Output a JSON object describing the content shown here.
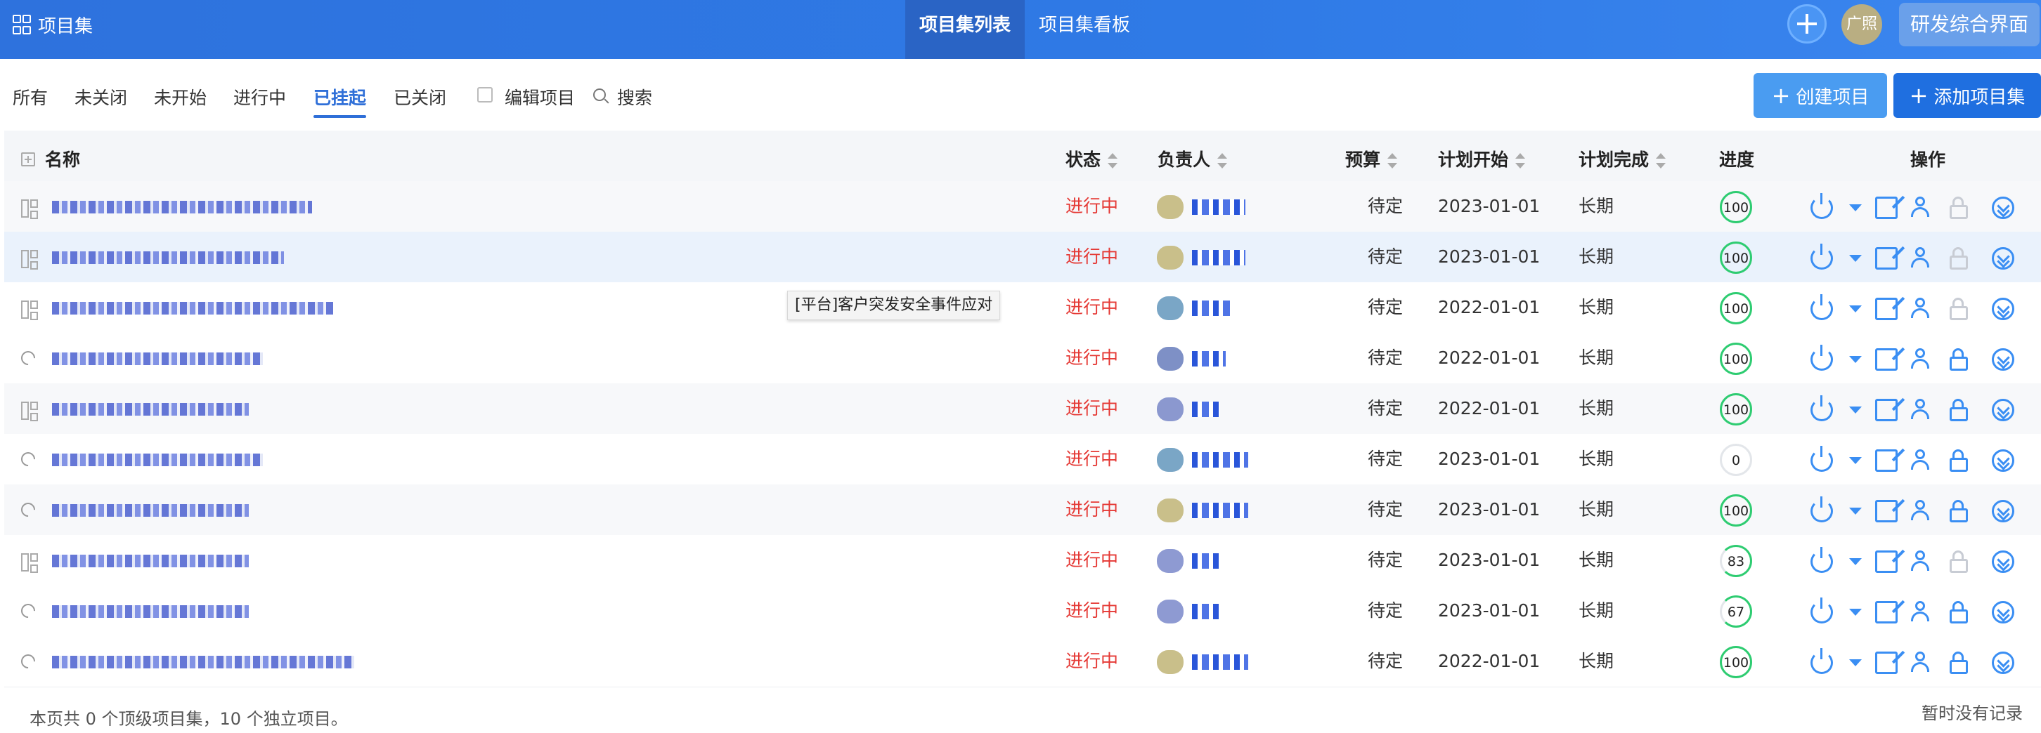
{
  "header": {
    "app_title": "项目集",
    "tabs": [
      {
        "label": "项目集列表",
        "active": true
      },
      {
        "label": "项目集看板",
        "active": false
      }
    ],
    "user_name": "广照",
    "rd_button": "研发综合界面"
  },
  "filters": {
    "tabs": [
      "所有",
      "未关闭",
      "未开始",
      "进行中",
      "已挂起",
      "已关闭"
    ],
    "active_tab": "已挂起",
    "edit_checkbox_label": "编辑项目",
    "search_label": "搜索"
  },
  "actions": {
    "create_project": "创建项目",
    "add_program": "添加项目集"
  },
  "table": {
    "headers": {
      "name": "名称",
      "status": "状态",
      "owner": "负责人",
      "budget": "预算",
      "plan_start": "计划开始",
      "plan_end": "计划完成",
      "progress": "进度",
      "ops": "操作"
    },
    "rows": [
      {
        "type": "program",
        "status": "进行中",
        "budget": "待定",
        "plan_start": "2023-01-01",
        "plan_end": "长期",
        "progress": "100",
        "progress_value": 100,
        "locked": false
      },
      {
        "type": "program",
        "status": "进行中",
        "budget": "待定",
        "plan_start": "2023-01-01",
        "plan_end": "长期",
        "progress": "100",
        "progress_value": 100,
        "locked": false
      },
      {
        "type": "program",
        "status": "进行中",
        "budget": "待定",
        "plan_start": "2022-01-01",
        "plan_end": "长期",
        "progress": "100",
        "progress_value": 100,
        "locked": false
      },
      {
        "type": "project",
        "status": "进行中",
        "budget": "待定",
        "plan_start": "2022-01-01",
        "plan_end": "长期",
        "progress": "100",
        "progress_value": 100,
        "locked": true
      },
      {
        "type": "program",
        "status": "进行中",
        "budget": "待定",
        "plan_start": "2022-01-01",
        "plan_end": "长期",
        "progress": "100",
        "progress_value": 100,
        "locked": true
      },
      {
        "type": "project",
        "status": "进行中",
        "budget": "待定",
        "plan_start": "2023-01-01",
        "plan_end": "长期",
        "progress": "0",
        "progress_value": 0,
        "locked": true
      },
      {
        "type": "project",
        "status": "进行中",
        "budget": "待定",
        "plan_start": "2023-01-01",
        "plan_end": "长期",
        "progress": "100",
        "progress_value": 100,
        "locked": true
      },
      {
        "type": "program",
        "status": "进行中",
        "budget": "待定",
        "plan_start": "2023-01-01",
        "plan_end": "长期",
        "progress": "83",
        "progress_value": 83,
        "locked": false
      },
      {
        "type": "project",
        "status": "进行中",
        "budget": "待定",
        "plan_start": "2023-01-01",
        "plan_end": "长期",
        "progress": "67",
        "progress_value": 67,
        "locked": true
      },
      {
        "type": "project",
        "status": "进行中",
        "budget": "待定",
        "plan_start": "2022-01-01",
        "plan_end": "长期",
        "progress": "100",
        "progress_value": 100,
        "locked": true
      }
    ]
  },
  "tooltip": "[平台]客户突发安全事件应对",
  "footer": {
    "summary": "本页共 0 个顶级项目集，10 个独立项目。",
    "no_records": "暂时没有记录"
  },
  "colors": {
    "header_bg": "#2e72dd",
    "accent": "#3a8ef3",
    "status_red": "#e53935",
    "progress_green": "#2ecc71"
  }
}
